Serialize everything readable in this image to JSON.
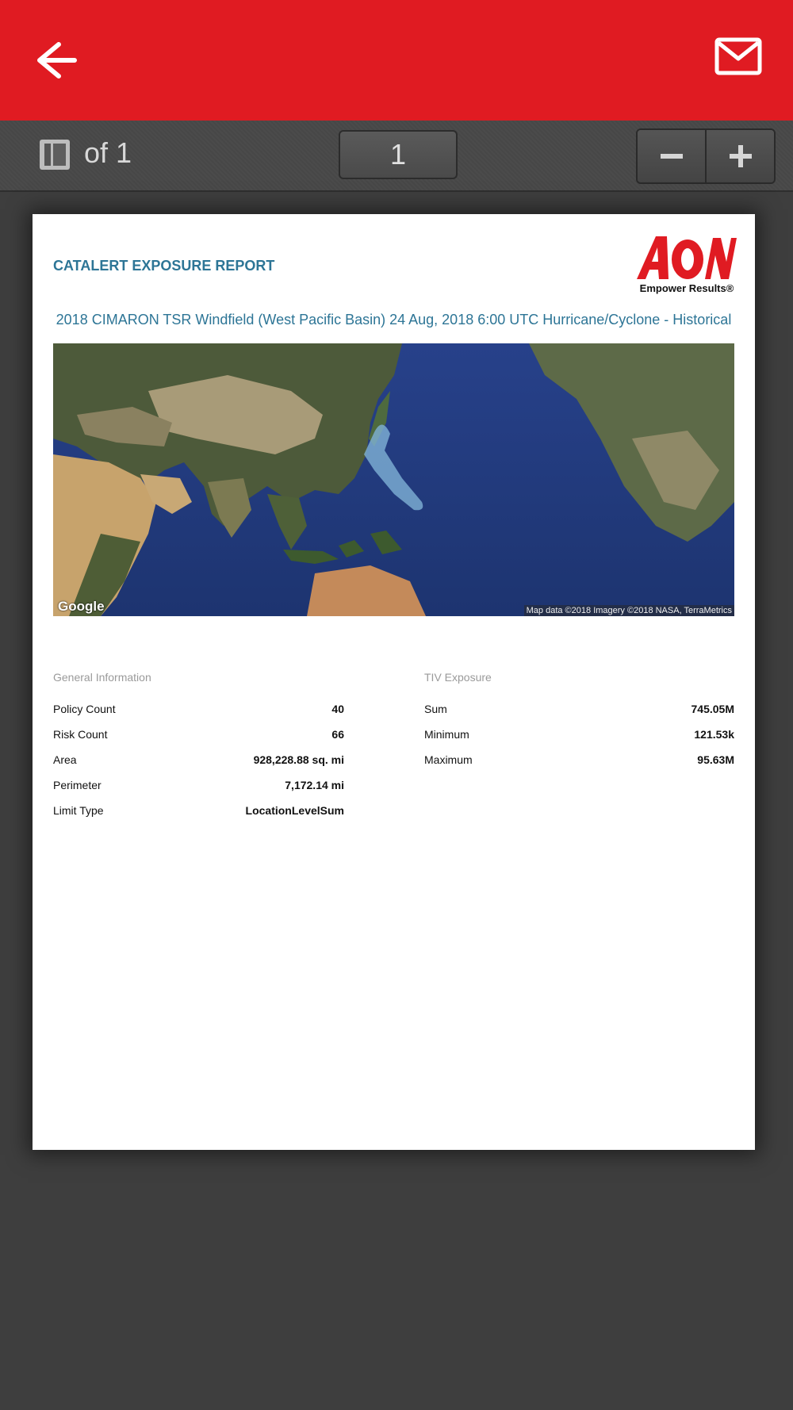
{
  "toolbar": {
    "of_pages": "of 1",
    "page_number": "1"
  },
  "report": {
    "title": "CATALERT EXPOSURE REPORT",
    "logo_text": "AON",
    "logo_tagline": "Empower Results®",
    "event_title": "2018 CIMARON TSR Windfield (West Pacific Basin) 24 Aug, 2018 6:00 UTC Hurricane/Cyclone - Historical",
    "map": {
      "google_label": "Google",
      "attribution": "Map data ©2018  Imagery ©2018 NASA, TerraMetrics"
    },
    "general": {
      "heading": "General Information",
      "rows": [
        {
          "label": "Policy Count",
          "value": "40"
        },
        {
          "label": "Risk Count",
          "value": "66"
        },
        {
          "label": "Area",
          "value": "928,228.88 sq. mi"
        },
        {
          "label": "Perimeter",
          "value": "7,172.14 mi"
        },
        {
          "label": "Limit Type",
          "value": "LocationLevelSum"
        }
      ]
    },
    "tiv": {
      "heading": "TIV Exposure",
      "rows": [
        {
          "label": "Sum",
          "value": "745.05M"
        },
        {
          "label": "Minimum",
          "value": "121.53k"
        },
        {
          "label": "Maximum",
          "value": "95.63M"
        }
      ]
    }
  },
  "colors": {
    "brand_red": "#e01b22",
    "report_blue": "#2d7596"
  }
}
